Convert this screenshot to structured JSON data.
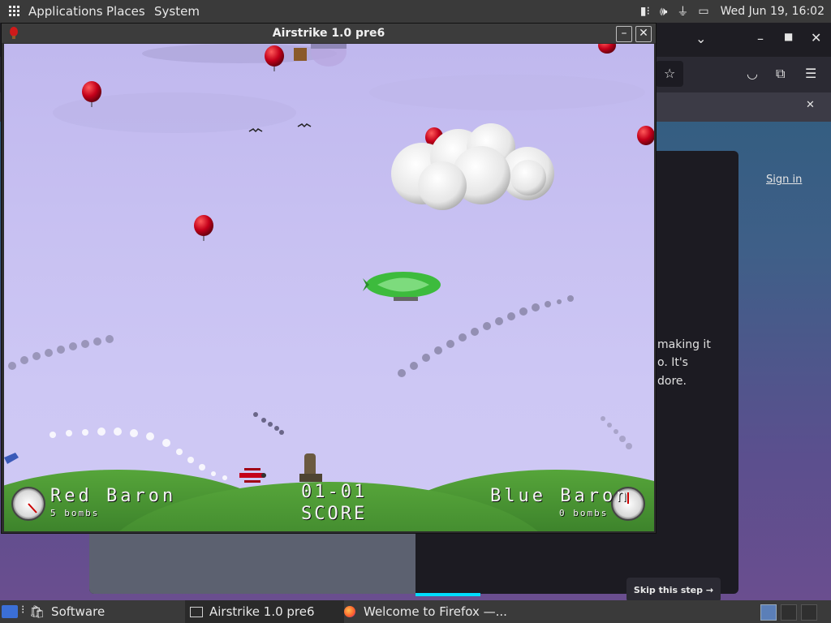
{
  "top_panel": {
    "applications": "Applications",
    "places": "Places",
    "system": "System",
    "clock": "Wed Jun 19, 16:02"
  },
  "firefox": {
    "sign_in": "Sign in",
    "text_line1": "making it",
    "text_line2": "o. It's",
    "text_line3": "dore.",
    "skip": "Skip this step →"
  },
  "game_window": {
    "title": "Airstrike 1.0 pre6"
  },
  "hud": {
    "left_player": "Red Baron",
    "left_bombs": "5 bombs",
    "score_value": "01-01",
    "score_label": "SCORE",
    "right_player": "Blue Baron",
    "right_bombs": "0 bombs"
  },
  "taskbar": {
    "software": "Software",
    "airstrike": "Airstrike 1.0 pre6",
    "firefox": "Welcome to Firefox —..."
  },
  "colors": {
    "sky": "#c8c1f2",
    "hill": "#3e8a2a",
    "balloon": "#c4001a",
    "zeppelin": "#3dbb3d",
    "firefox_accent": "#00ddff"
  }
}
